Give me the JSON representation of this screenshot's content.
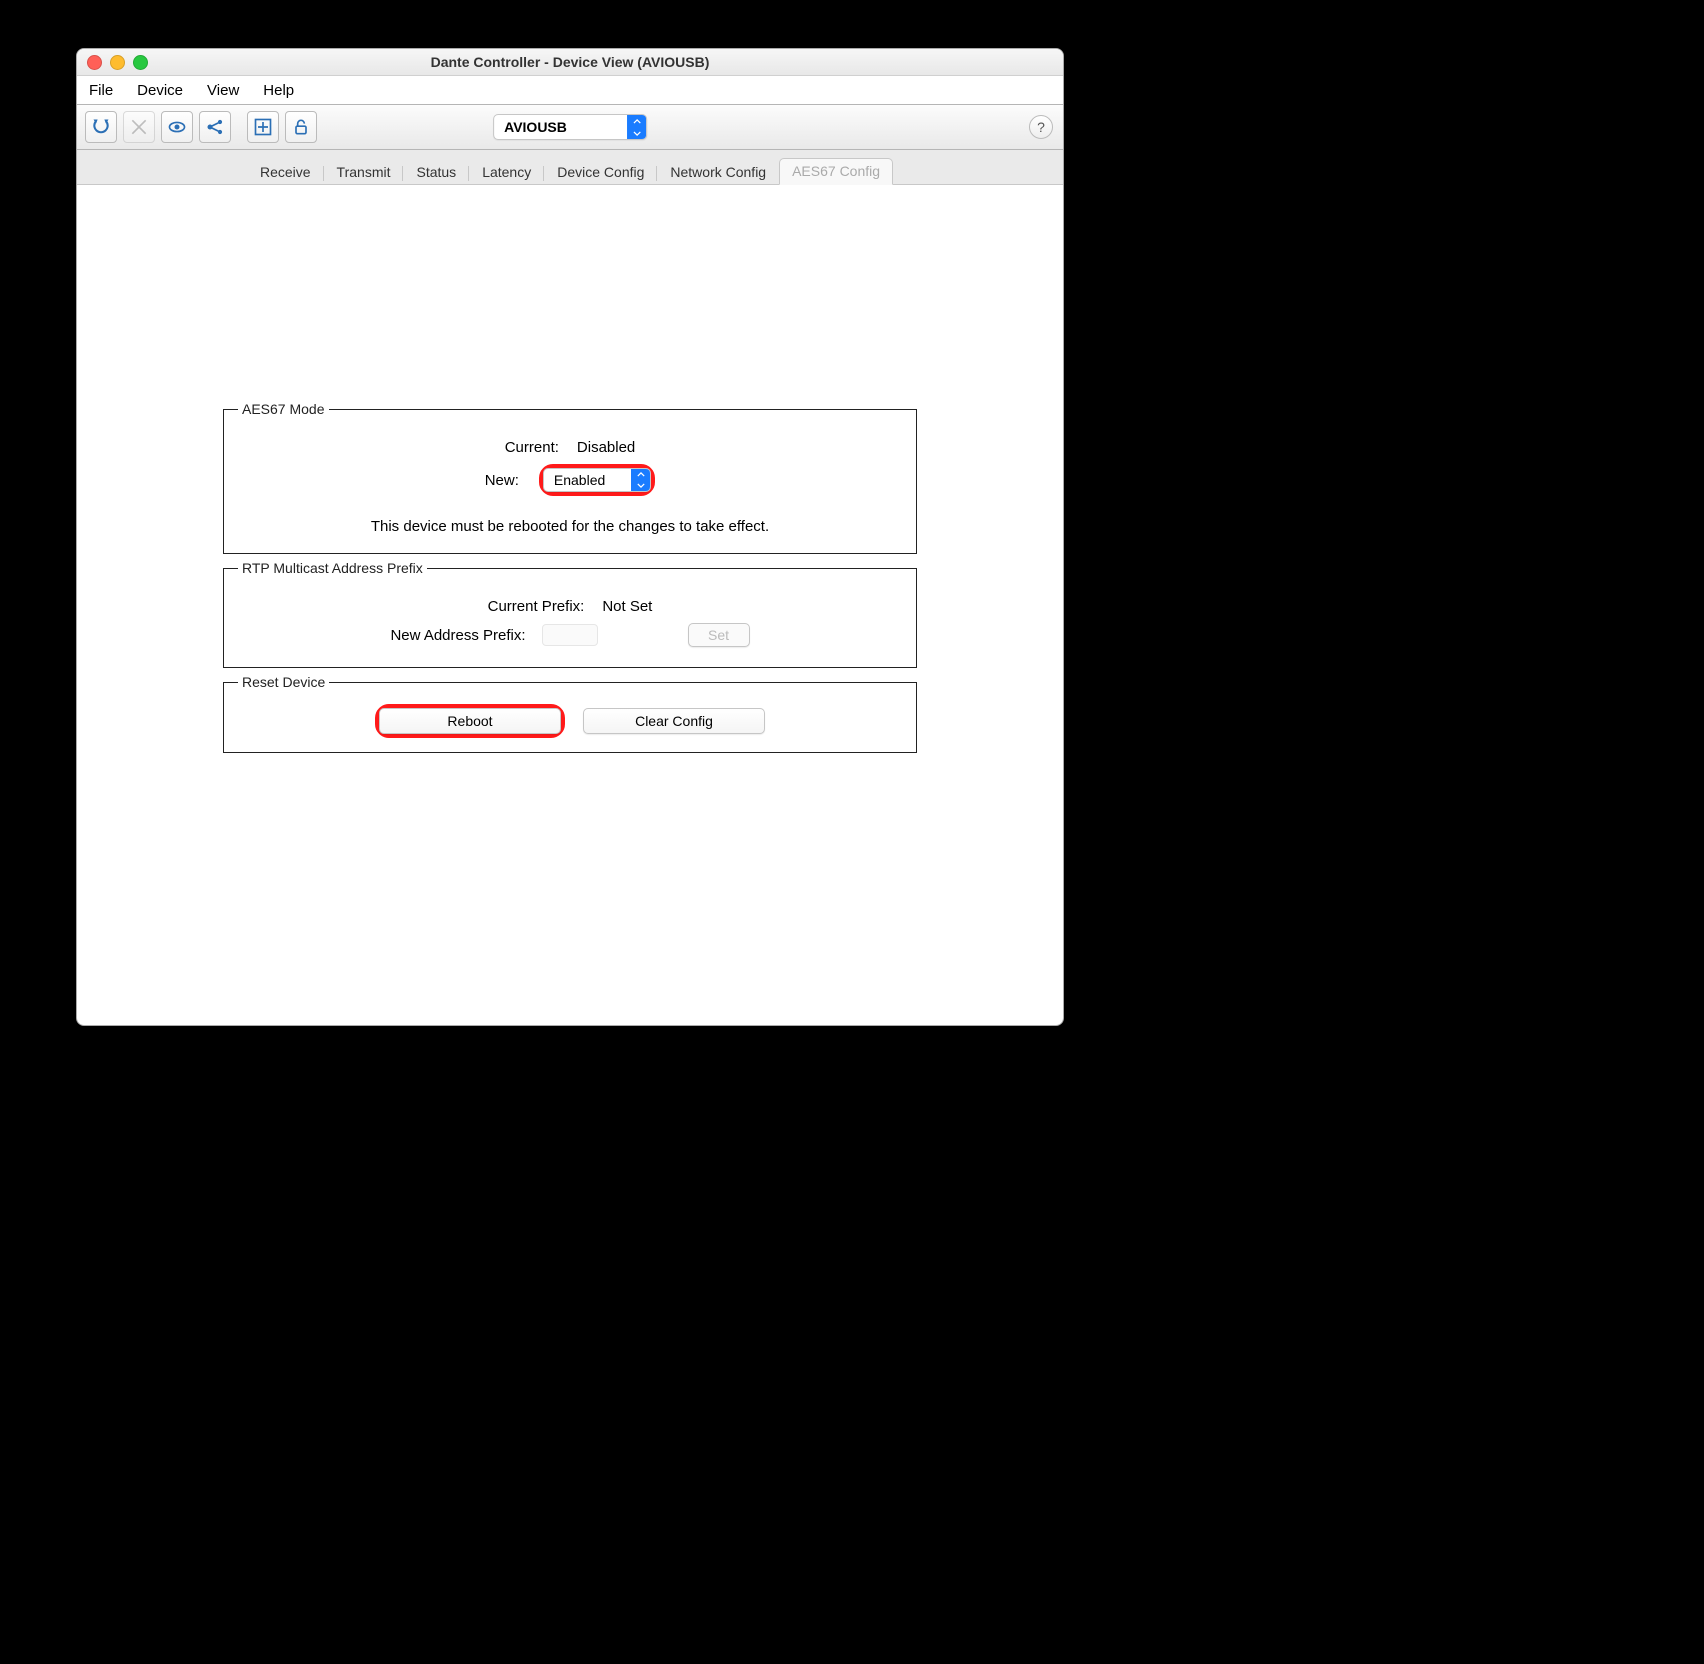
{
  "window": {
    "title": "Dante Controller - Device View (AVIOUSB)"
  },
  "menubar": [
    "File",
    "Device",
    "View",
    "Help"
  ],
  "toolbar": {
    "device_selected": "AVIOUSB",
    "help": "?"
  },
  "tabs": [
    "Receive",
    "Transmit",
    "Status",
    "Latency",
    "Device Config",
    "Network Config",
    "AES67 Config"
  ],
  "aes67": {
    "legend": "AES67 Mode",
    "current_label": "Current:",
    "current_value": "Disabled",
    "new_label": "New:",
    "new_value": "Enabled",
    "note": "This device must be rebooted for the changes to take effect."
  },
  "rtp": {
    "legend": "RTP Multicast Address Prefix",
    "current_label": "Current Prefix:",
    "current_value": "Not Set",
    "new_label": "New Address Prefix:",
    "set_label": "Set"
  },
  "reset": {
    "legend": "Reset Device",
    "reboot": "Reboot",
    "clear": "Clear Config"
  }
}
